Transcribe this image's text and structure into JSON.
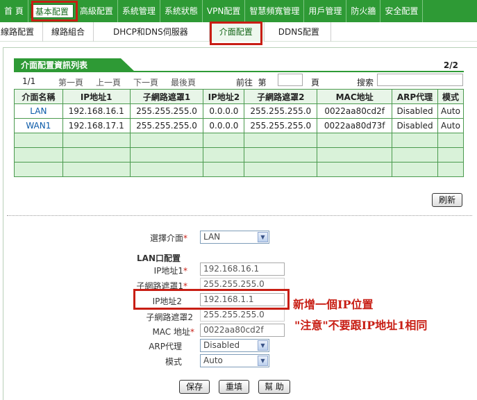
{
  "topnav": [
    "首 頁",
    "基本配置",
    "高級配置",
    "系統管理",
    "系統狀態",
    "VPN配置",
    "智慧頻寬管理",
    "用戶管理",
    "防火牆",
    "安全配置"
  ],
  "subnav": [
    "線路配置",
    "線路組合",
    "DHCP和DNS伺服器",
    "介面配置",
    "DDNS配置"
  ],
  "table_header": {
    "title": "介面配置資訊列表",
    "page_info": "2/2"
  },
  "pager": {
    "page": "1/1",
    "first": "第一頁",
    "prev": "上一頁",
    "next": "下一頁",
    "last": "最後頁",
    "goto": "前往  第",
    "page_unit": "頁",
    "search": "搜索"
  },
  "table": {
    "columns": [
      "介面名稱",
      "IP地址1",
      "子網路遮罩1",
      "IP地址2",
      "子網路遮罩2",
      "MAC地址",
      "ARP代理",
      "模式"
    ],
    "rows": [
      [
        "LAN",
        "192.168.16.1",
        "255.255.255.0",
        "0.0.0.0",
        "255.255.255.0",
        "0022aa80cd2f",
        "Disabled",
        "Auto"
      ],
      [
        "WAN1",
        "192.168.17.1",
        "255.255.255.0",
        "0.0.0.0",
        "255.255.255.0",
        "0022aa80d73f",
        "Disabled",
        "Auto"
      ]
    ]
  },
  "refresh_label": "刷新",
  "form": {
    "select_iface_label": "選擇介面",
    "select_iface_value": "LAN",
    "section_title": "LAN口配置",
    "ip1_label": "IP地址1",
    "ip1_value": "192.168.16.1",
    "mask1_label": "子網路遮罩1",
    "mask1_value": "255.255.255.0",
    "ip2_label": "IP地址2",
    "ip2_value": "192.168.1.1",
    "mask2_label": "子網路遮罩2",
    "mask2_value": "255.255.255.0",
    "mac_label": "MAC 地址",
    "mac_value": "0022aa80cd2f",
    "arp_label": "ARP代理",
    "arp_value": "Disabled",
    "mode_label": "模式",
    "mode_value": "Auto"
  },
  "buttons": {
    "save": "保存",
    "reset": "重填",
    "help": "幫 助"
  },
  "annotations": {
    "line1": "新增一個IP位置",
    "line2": "\"注意\"不要跟IP地址1相同"
  },
  "colors": {
    "nav_green": "#2e9a35",
    "highlight_red": "#c81e14",
    "row_green": "#d9f2d9"
  }
}
